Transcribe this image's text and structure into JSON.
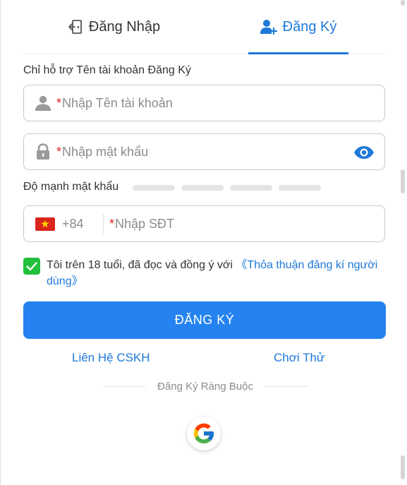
{
  "tabs": {
    "login_label": "Đăng Nhập",
    "register_label": "Đăng Ký",
    "active": "register"
  },
  "form": {
    "hint": "Chỉ hỗ trợ Tên tài khoản Đăng Ký",
    "required_mark": "*",
    "username_placeholder": "Nhập Tên tài khoản",
    "password_placeholder": "Nhập mật khẩu",
    "password_strength_label": "Độ mạnh mật khẩu",
    "password_strength_level": 0,
    "country_code": "+84",
    "phone_placeholder": "Nhập SĐT"
  },
  "agreement": {
    "checked": true,
    "text": "Tôi trên 18 tuổi, đã đọc và đồng ý với ",
    "link_text": "《Thỏa thuận đăng kí người dùng》"
  },
  "actions": {
    "submit_label": "ĐĂNG KÝ",
    "contact_label": "Liên Hệ CSKH",
    "trial_label": "Chơi Thử",
    "bind_label": "Đăng Ký Ràng Buộc"
  },
  "icons": {
    "login_tab": "door-exit-icon",
    "register_tab": "user-add-icon",
    "username": "user-icon",
    "password": "lock-icon",
    "show_password": "eye-icon",
    "country": "vietnam-flag-icon",
    "checkbox": "check-icon",
    "google": "google-icon"
  },
  "colors": {
    "accent": "#1f79d8",
    "button": "#2583f1",
    "required": "#e02424",
    "checkbox": "#22c03c"
  }
}
